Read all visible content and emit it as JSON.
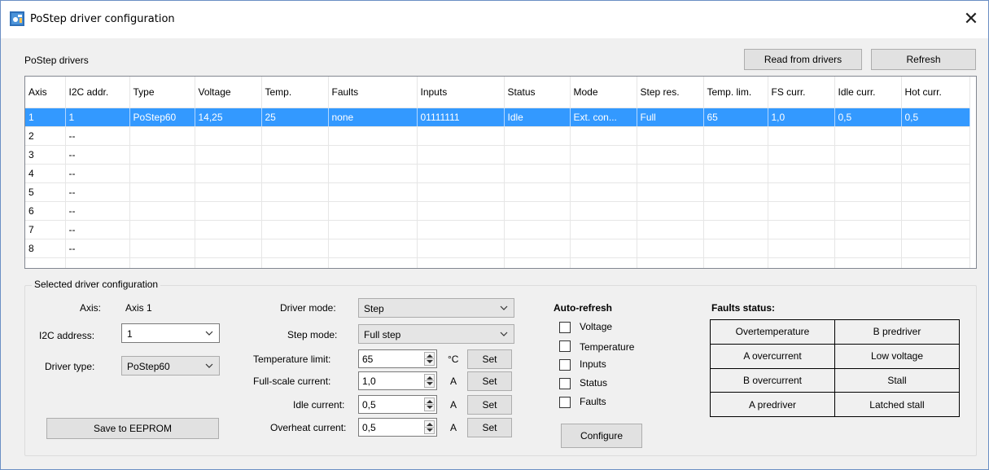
{
  "window": {
    "title": "PoStep driver configuration",
    "close_glyph": "✕",
    "icon": "app-icon"
  },
  "drivers": {
    "section_label": "PoStep drivers",
    "read_button": "Read from drivers",
    "refresh_button": "Refresh",
    "columns": [
      "Axis",
      "I2C addr.",
      "Type",
      "Voltage",
      "Temp.",
      "Faults",
      "Inputs",
      "Status",
      "Mode",
      "Step res.",
      "Temp. lim.",
      "FS curr.",
      "Idle curr.",
      "Hot curr."
    ],
    "rows": [
      [
        "1",
        "1",
        "PoStep60",
        "14,25",
        "25",
        "none",
        "01111111",
        "Idle",
        "Ext. con...",
        "Full",
        "65",
        "1,0",
        "0,5",
        "0,5"
      ],
      [
        "2",
        "--",
        "",
        "",
        "",
        "",
        "",
        "",
        "",
        "",
        "",
        "",
        "",
        ""
      ],
      [
        "3",
        "--",
        "",
        "",
        "",
        "",
        "",
        "",
        "",
        "",
        "",
        "",
        "",
        ""
      ],
      [
        "4",
        "--",
        "",
        "",
        "",
        "",
        "",
        "",
        "",
        "",
        "",
        "",
        "",
        ""
      ],
      [
        "5",
        "--",
        "",
        "",
        "",
        "",
        "",
        "",
        "",
        "",
        "",
        "",
        "",
        ""
      ],
      [
        "6",
        "--",
        "",
        "",
        "",
        "",
        "",
        "",
        "",
        "",
        "",
        "",
        "",
        ""
      ],
      [
        "7",
        "--",
        "",
        "",
        "",
        "",
        "",
        "",
        "",
        "",
        "",
        "",
        "",
        ""
      ],
      [
        "8",
        "--",
        "",
        "",
        "",
        "",
        "",
        "",
        "",
        "",
        "",
        "",
        "",
        ""
      ]
    ],
    "selected_row": 0,
    "selection_color": "#3399ff"
  },
  "config": {
    "group_title": "Selected driver configuration",
    "axis_label": "Axis:",
    "axis_value": "Axis 1",
    "i2c_label": "I2C address:",
    "i2c_value": "1",
    "type_label": "Driver type:",
    "type_value": "PoStep60",
    "save_button": "Save to EEPROM",
    "driver_mode_label": "Driver mode:",
    "driver_mode_value": "Step",
    "step_mode_label": "Step mode:",
    "step_mode_value": "Full step",
    "temp_limit_label": "Temperature limit:",
    "temp_limit_value": "65",
    "temp_limit_unit": "°C",
    "fs_current_label": "Full-scale current:",
    "fs_current_value": "1,0",
    "fs_current_unit": "A",
    "idle_current_label": "Idle current:",
    "idle_current_value": "0,5",
    "idle_current_unit": "A",
    "overheat_current_label": "Overheat current:",
    "overheat_current_value": "0,5",
    "overheat_current_unit": "A",
    "set_button": "Set"
  },
  "auto_refresh": {
    "title": "Auto-refresh",
    "options": [
      {
        "label": "Voltage",
        "checked": false
      },
      {
        "label": "Temperature",
        "checked": false
      },
      {
        "label": "Inputs",
        "checked": false
      },
      {
        "label": "Status",
        "checked": false
      },
      {
        "label": "Faults",
        "checked": false
      }
    ],
    "configure_button": "Configure"
  },
  "faults_status": {
    "title": "Faults status:",
    "cells": [
      [
        "Overtemperature",
        "B predriver"
      ],
      [
        "A overcurrent",
        "Low voltage"
      ],
      [
        "B overcurrent",
        "Stall"
      ],
      [
        "A predriver",
        "Latched stall"
      ]
    ]
  }
}
